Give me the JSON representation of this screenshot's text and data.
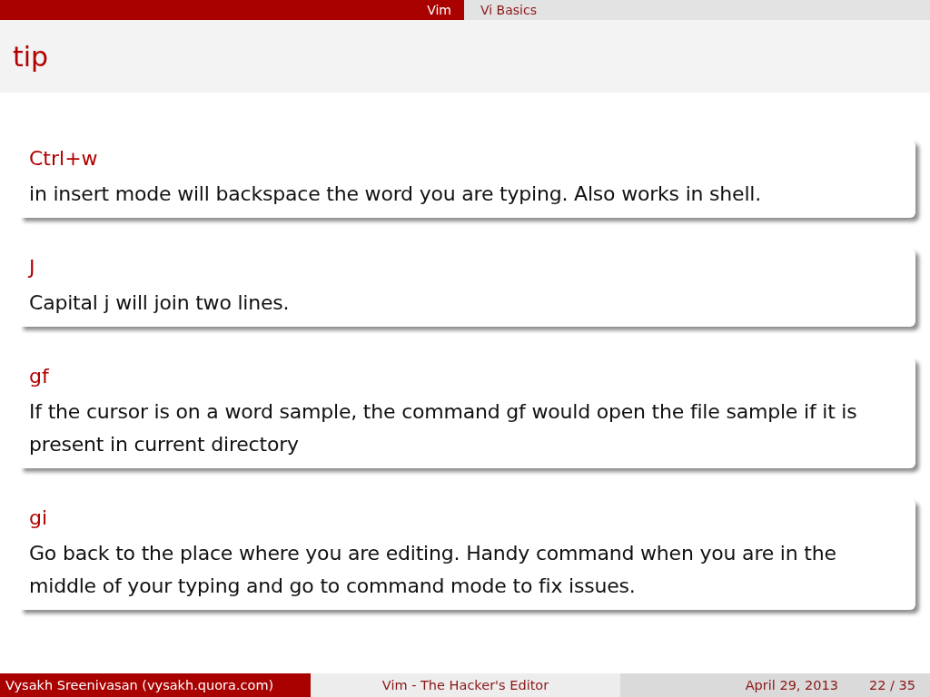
{
  "header": {
    "section": "Vim",
    "subsection": "Vi Basics"
  },
  "frame_title": "tip",
  "blocks": [
    {
      "title": "Ctrl+w",
      "body": "in insert mode will backspace the word you are typing.  Also works in shell."
    },
    {
      "title": "J",
      "body": "Capital j will join two lines."
    },
    {
      "title": "gf",
      "body": "If the cursor is on a word sample, the command gf would open the file sample if it is present in current directory"
    },
    {
      "title": "gi",
      "body": "Go back to the place where you are editing.  Handy command when you are in the middle of your typing and go to command mode to fix issues."
    }
  ],
  "footer": {
    "author": "Vysakh Sreenivasan  (vysakh.quora.com)",
    "title": "Vim - The Hacker's Editor",
    "date": "April 29, 2013",
    "page": "22 / 35"
  }
}
